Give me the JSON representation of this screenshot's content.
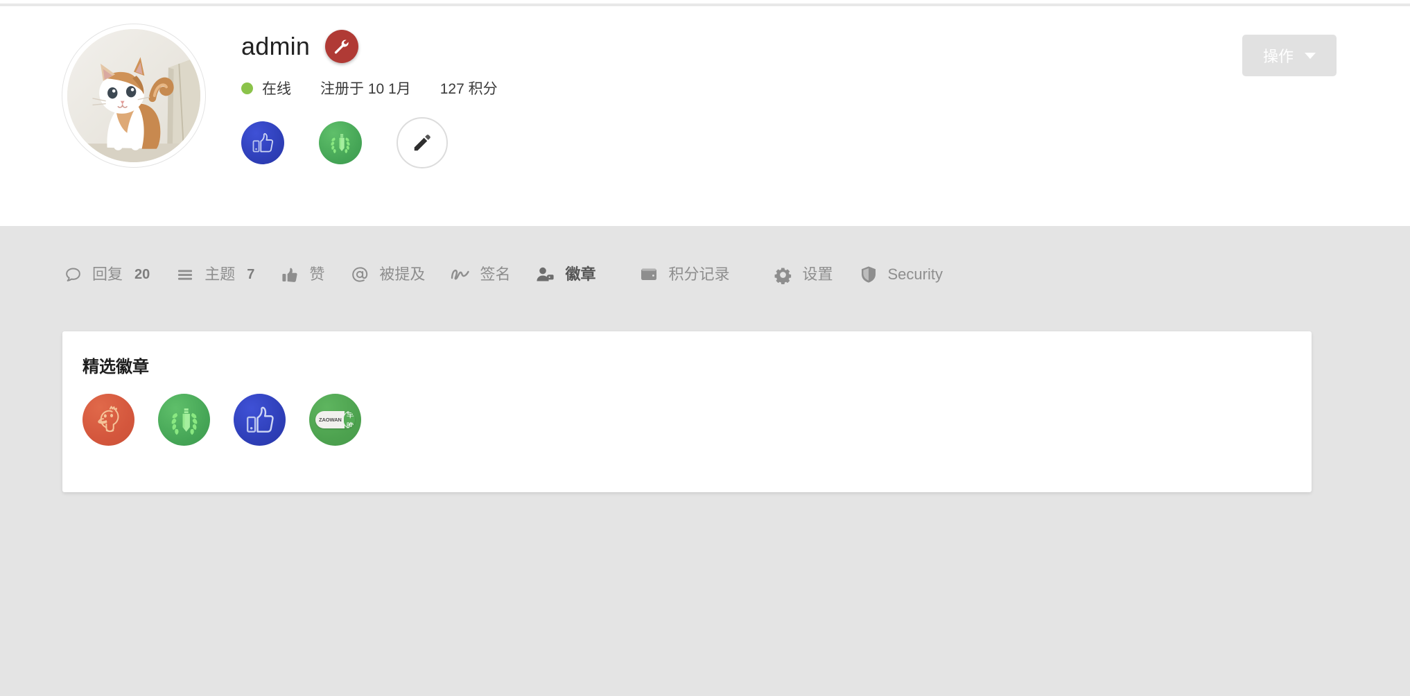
{
  "profile": {
    "username": "admin",
    "role_badge_icon": "wrench-icon",
    "avatar_alt": "cat-avatar",
    "status_label": "在线",
    "joined_label": "注册于 10 1月",
    "points_label": "127 积分",
    "status_color": "#8bc34a",
    "role_badge_color": "#b03a35"
  },
  "header_actions": {
    "actions_label": "操作"
  },
  "header_badges": [
    {
      "name": "like-badge",
      "icon": "thumbs-up-icon",
      "color": "#2e3fb8"
    },
    {
      "name": "laurel-pencil-badge",
      "icon": "laurel-pencil-icon",
      "color": "#45a556"
    },
    {
      "name": "edit-badge",
      "icon": "pencil-icon",
      "color": "#ffffff"
    }
  ],
  "nav": {
    "items": [
      {
        "id": "replies",
        "icon": "speech-bubble-icon",
        "label": "回复",
        "count": "20",
        "active": false
      },
      {
        "id": "topics",
        "icon": "list-icon",
        "label": "主题",
        "count": "7",
        "active": false
      },
      {
        "id": "likes",
        "icon": "thumbs-up-icon",
        "label": "赞",
        "count": "",
        "active": false
      },
      {
        "id": "mentions",
        "icon": "at-icon",
        "label": "被提及",
        "count": "",
        "active": false
      },
      {
        "id": "signature",
        "icon": "squiggle-icon",
        "label": "签名",
        "count": "",
        "active": false
      },
      {
        "id": "badges",
        "icon": "person-tag-icon",
        "label": "徽章",
        "count": "",
        "active": true
      },
      {
        "id": "points",
        "icon": "wallet-icon",
        "label": "积分记录",
        "count": "",
        "active": false
      },
      {
        "id": "settings",
        "icon": "gear-icon",
        "label": "设置",
        "count": "",
        "active": false
      },
      {
        "id": "security",
        "icon": "shield-icon",
        "label": "Security",
        "count": "",
        "active": false
      }
    ]
  },
  "panel": {
    "title": "精选徽章",
    "badges": [
      {
        "id": "duck",
        "icon": "duck-icon",
        "label": "",
        "color": "#d4573d"
      },
      {
        "id": "laurel",
        "icon": "laurel-pencil-icon",
        "label": "",
        "color": "#4da24f"
      },
      {
        "id": "like",
        "icon": "thumbs-up-icon",
        "label": "",
        "color": "#2e3fb8"
      },
      {
        "id": "zaowan",
        "icon": "pill-badge-icon",
        "label_en": "ZAOWAN",
        "label_zh": "早晚",
        "color": "#4da24f"
      }
    ]
  }
}
